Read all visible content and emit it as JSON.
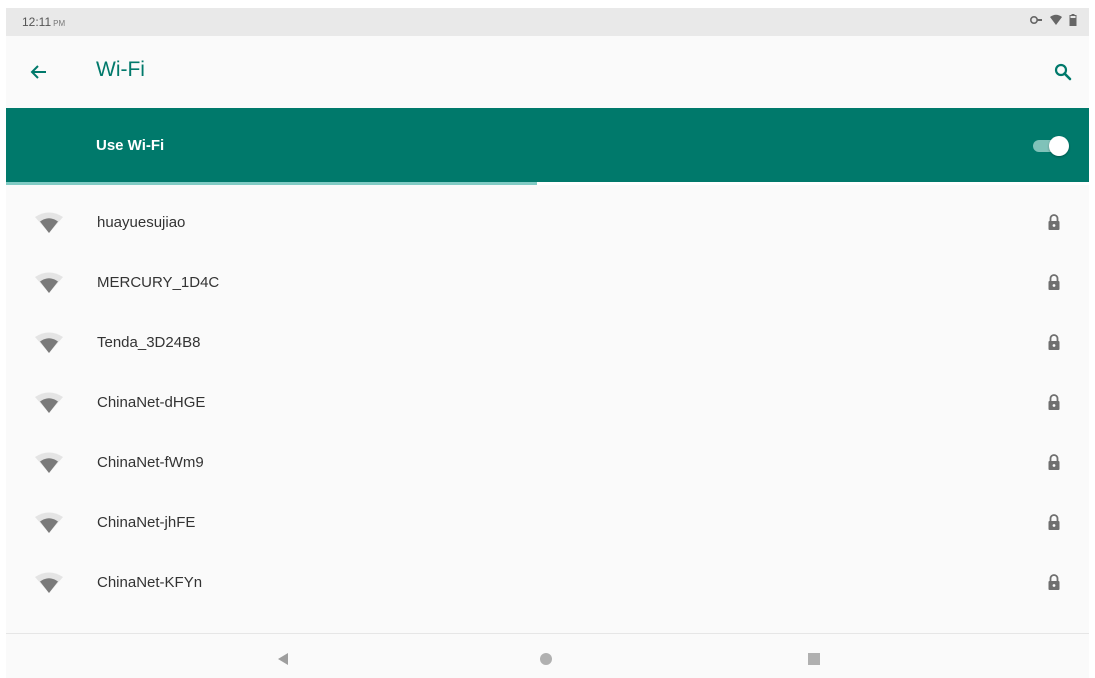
{
  "status_bar": {
    "time": "12:11",
    "ampm": "PM",
    "icons": [
      "vpn-key-icon",
      "wifi-signal-icon",
      "battery-icon"
    ]
  },
  "app_bar": {
    "title": "Wi-Fi",
    "back_icon": "arrow-back-icon",
    "search_icon": "search-icon"
  },
  "wifi_toggle": {
    "label": "Use Wi-Fi",
    "state": "on"
  },
  "scan_progress": {
    "fraction": 0.49
  },
  "networks": [
    {
      "name": "huayuesujiao",
      "secured": true
    },
    {
      "name": "MERCURY_1D4C",
      "secured": true
    },
    {
      "name": "Tenda_3D24B8",
      "secured": true
    },
    {
      "name": "ChinaNet-dHGE",
      "secured": true
    },
    {
      "name": "ChinaNet-fWm9",
      "secured": true
    },
    {
      "name": "ChinaNet-jhFE",
      "secured": true
    },
    {
      "name": "ChinaNet-KFYn",
      "secured": true
    }
  ],
  "nav_bar": {
    "icons": [
      "nav-back-icon",
      "nav-home-icon",
      "nav-recents-icon"
    ]
  },
  "colors": {
    "accent": "#00796b",
    "toggle_track": "#7fc2b9",
    "progress": "#80cbc4",
    "background": "#fafafa",
    "status_bar": "#e9e9e9"
  }
}
